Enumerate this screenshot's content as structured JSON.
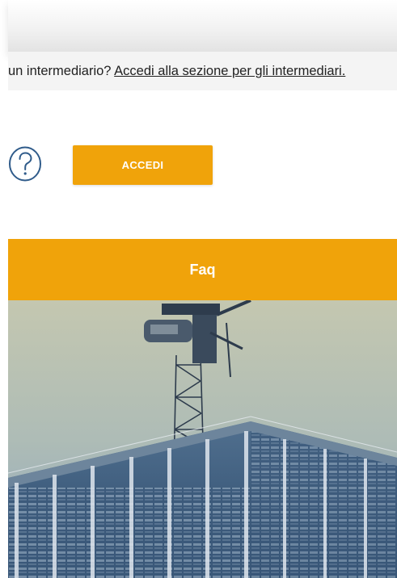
{
  "notice": {
    "prefix": "un intermediario? ",
    "link": "Accedi alla sezione per gli intermediari."
  },
  "login": {
    "help_icon": "question-circle-icon",
    "button_label": "ACCEDI"
  },
  "faq": {
    "label": "Faq"
  },
  "hero": {
    "image": "building-construction-crane-photo"
  },
  "colors": {
    "accent": "#f0a30a",
    "icon": "#2f5b8a",
    "notice_bg": "#f4f4f4"
  }
}
